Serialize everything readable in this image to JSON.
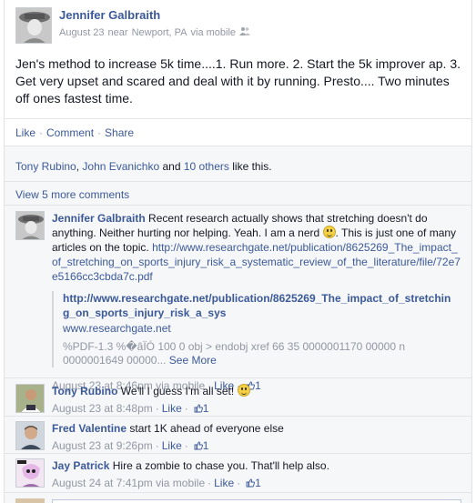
{
  "post": {
    "author": "Jennifer Galbraith",
    "date": "August 23",
    "location_prefix": "near",
    "location": "Newport, PA",
    "via": "via mobile",
    "text": "Jen's method to increase 5k time....1. Run more. 2. Start the 5k improver ap. 3. Get very upset and scared and deal with it by running. Presto.... Two minutes off ones fastest time."
  },
  "actions": {
    "like": "Like",
    "comment": "Comment",
    "share": "Share"
  },
  "likes": {
    "user1": "Tony Rubino",
    "user2": "John Evanichko",
    "and": "and",
    "others": "10 others",
    "suffix": "like this."
  },
  "view_more": "View 5 more comments",
  "comments": [
    {
      "author": "Jennifer Galbraith",
      "text_before": "Recent research actually shows that stretching doesn't do anything. Neither hurting nor helping. Yeah. I am a nerd",
      "text_after": ". This is just one of many articles on the topic.",
      "link": "http://www.researchgate.net/publication/8625269_The_impact_of_stretching_on_sports_injury_risk_a_systematic_review_of_the_literature/file/72e7e5166cc3cbda7c.pdf",
      "preview": {
        "title": "http://www.researchgate.net/publication/8625269_The_impact_of_stretching_on_sports_injury_risk_a_sys",
        "domain": "www.researchgate.net",
        "excerpt": "%PDF-1.3 %�âÏÓ 100 0 obj > endobj xref 66 35 0000001170 00000 n 0000001649 00000...",
        "see_more": "See More"
      },
      "time": "August 23 at 8:46pm",
      "via": "via mobile",
      "like": "Like",
      "likes": "1"
    },
    {
      "author": "Tony Rubino",
      "text": "We'll I guess I'm all set!",
      "time": "August 23 at 8:48pm",
      "like": "Like",
      "likes": "1"
    },
    {
      "author": "Fred Valentine",
      "text": "start 1K ahead of everyone else",
      "time": "August 23 at 9:26pm",
      "like": "Like",
      "likes": "1"
    },
    {
      "author": "Jay Patrick",
      "text": "Hire a zombie to chase you. That'll help also.",
      "time": "August 24 at 7:41pm",
      "via": "via mobile",
      "like": "Like",
      "likes": "1"
    }
  ],
  "colors": {
    "link": "#3b5998",
    "meta": "#9197a3",
    "feedback_bg": "#f6f7f9"
  },
  "icons": [
    "friends-icon",
    "smiley-icon",
    "thumbs-up-icon"
  ]
}
